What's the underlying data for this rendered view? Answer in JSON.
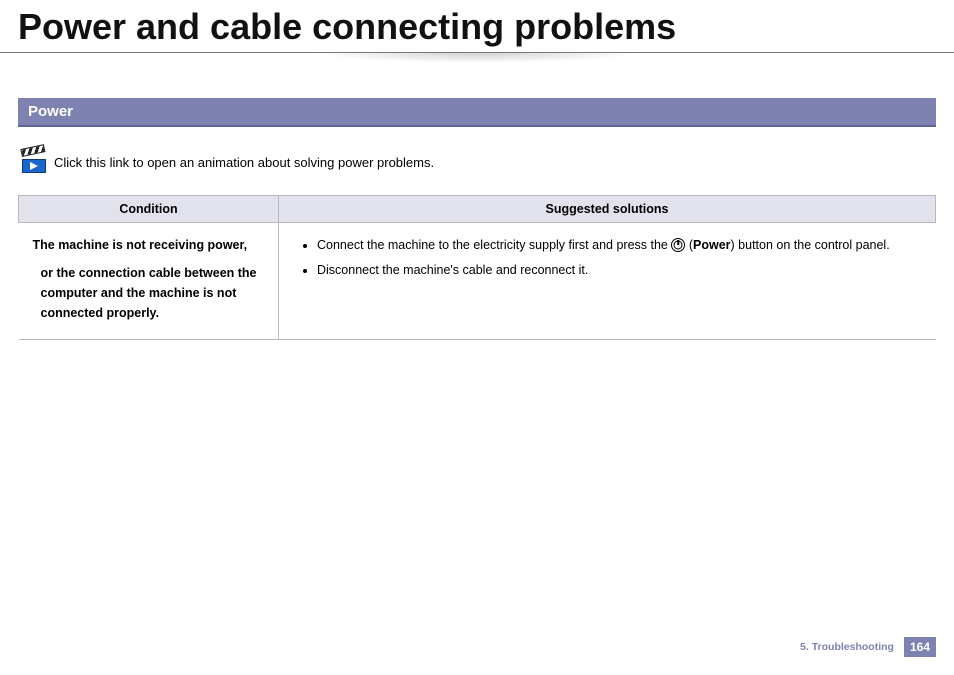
{
  "title": "Power and cable connecting problems",
  "section": {
    "header": "Power"
  },
  "link": {
    "icon_name": "video-animation-icon",
    "text": "Click this link to open an animation about solving power problems."
  },
  "table": {
    "headers": {
      "condition": "Condition",
      "solutions": "Suggested solutions"
    },
    "row": {
      "condition_line1": "The machine is not receiving power,",
      "condition_line2": "or the connection cable between the computer and the machine is not connected properly.",
      "solutions": {
        "s1_pre": "Connect the machine to the electricity supply first and press the ",
        "s1_open": "(",
        "s1_bold": "Power",
        "s1_post": ") button on the control panel.",
        "s2": "Disconnect the machine's cable and reconnect it."
      }
    }
  },
  "footer": {
    "chapter": "5.  Troubleshooting",
    "page": "164"
  }
}
